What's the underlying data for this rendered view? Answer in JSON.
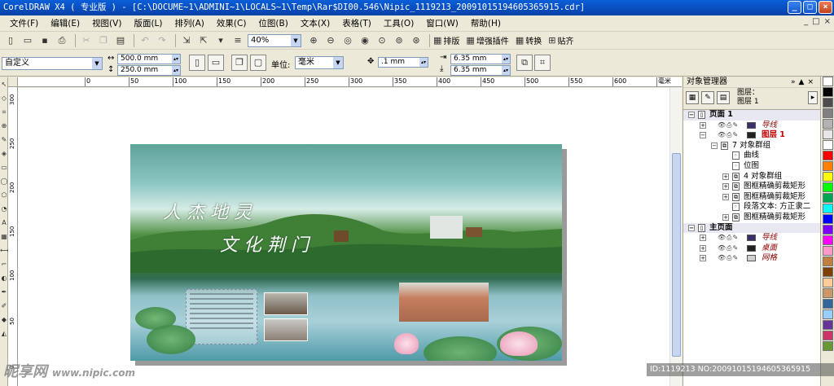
{
  "titlebar": {
    "title": "CorelDRAW X4 ( 专业版 ) - [C:\\DOCUME~1\\ADMINI~1\\LOCALS~1\\Temp\\Rar$DI00.546\\Nipic_1119213_20091015194605365915.cdr]",
    "minimize": "_",
    "maximize": "□",
    "close": "×"
  },
  "menu": {
    "items": [
      "文件(F)",
      "编辑(E)",
      "视图(V)",
      "版面(L)",
      "排列(A)",
      "效果(C)",
      "位图(B)",
      "文本(X)",
      "表格(T)",
      "工具(O)",
      "窗口(W)",
      "帮助(H)"
    ],
    "mdi": [
      "_",
      "□",
      "×"
    ]
  },
  "toolbar": {
    "zoom": "40%",
    "layout_label": "排版",
    "plugin_label": "增强插件",
    "convert_label": "转换",
    "snap_label": "贴齐"
  },
  "propbar": {
    "page_preset": "自定义",
    "width": "500.0 mm",
    "height": "250.0 mm",
    "unit_label": "单位:",
    "unit": "毫米",
    "nudge": ".1 mm",
    "dup_x": "6.35 mm",
    "dup_y": "6.35 mm"
  },
  "rulers": {
    "h_labels": [
      "0",
      "50",
      "100",
      "150",
      "200",
      "250",
      "300",
      "350",
      "400",
      "450",
      "500",
      "550",
      "600",
      "毫米"
    ],
    "v_labels": [
      "300",
      "250",
      "200",
      "150",
      "100",
      "50",
      "0"
    ]
  },
  "artwork": {
    "line1": "人杰地灵",
    "line2": "文化荆门"
  },
  "docker": {
    "title": "对象管理器",
    "layer_info_1": "图层：",
    "layer_info_2": "图层 1",
    "rows": [
      {
        "text": "页面 1",
        "indent": 0,
        "kind": "page"
      },
      {
        "text": "导线",
        "indent": 1,
        "kind": "layer",
        "color": "#3a2f6b",
        "italic": true
      },
      {
        "text": "图层 1",
        "indent": 1,
        "kind": "layer",
        "color": "#222222",
        "italic": false,
        "active": true
      },
      {
        "text": "7 对象群组",
        "indent": 2,
        "kind": "group"
      },
      {
        "text": "曲线",
        "indent": 3,
        "kind": "obj"
      },
      {
        "text": "位图",
        "indent": 3,
        "kind": "obj"
      },
      {
        "text": "4 对象群组",
        "indent": 3,
        "kind": "group"
      },
      {
        "text": "图框精确剪裁矩形",
        "indent": 3,
        "kind": "group"
      },
      {
        "text": "图框精确剪裁矩形",
        "indent": 3,
        "kind": "group"
      },
      {
        "text": "段落文本: 方正隶二",
        "indent": 3,
        "kind": "obj"
      },
      {
        "text": "图框精确剪裁矩形",
        "indent": 3,
        "kind": "group"
      },
      {
        "text": "主页面",
        "indent": 0,
        "kind": "page"
      },
      {
        "text": "导线",
        "indent": 1,
        "kind": "layer",
        "color": "#3a2f6b",
        "italic": true
      },
      {
        "text": "桌面",
        "indent": 1,
        "kind": "layer",
        "color": "#222222",
        "italic": true
      },
      {
        "text": "网格",
        "indent": 1,
        "kind": "layer",
        "color": "#cfcfcf",
        "italic": true
      }
    ]
  },
  "palette": [
    "#ffffff",
    "#000000",
    "#4d4d4d",
    "#808080",
    "#b3b3b3",
    "#e6e6e6",
    "#ffffff",
    "#ff0000",
    "#ff8000",
    "#ffff00",
    "#00ff00",
    "#00a651",
    "#00ffff",
    "#0000ff",
    "#8000ff",
    "#ff00ff",
    "#ff99cc",
    "#c08040",
    "#804000",
    "#ffcc99",
    "#cc9966",
    "#336699",
    "#99ccff",
    "#663399",
    "#cc3366",
    "#669933"
  ],
  "watermark": {
    "left_text": "昵享网",
    "left_url": "www.nipic.com",
    "right_text": "ID:1119213 NO:20091015194605365915"
  }
}
